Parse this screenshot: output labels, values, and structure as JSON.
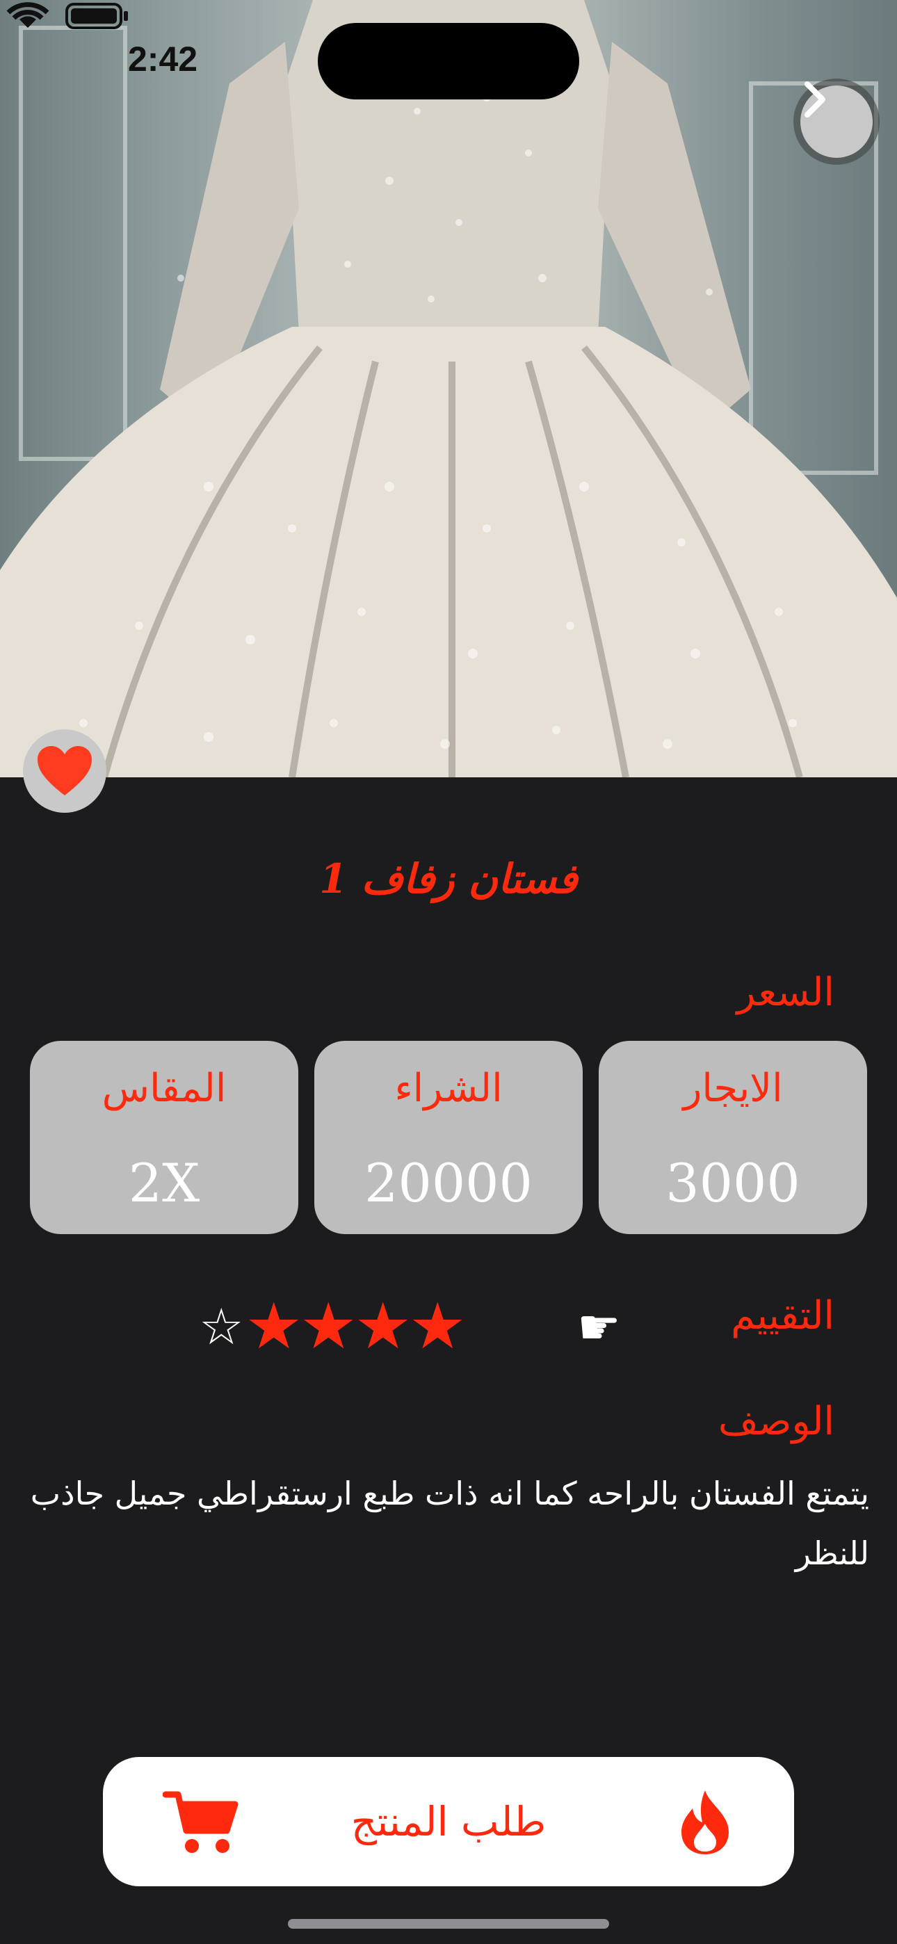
{
  "status_bar": {
    "time": "2:42"
  },
  "product": {
    "title": "فستان زفاف 1",
    "price_section_label": "السعر",
    "cards": [
      {
        "label": "الايجار",
        "value": "3000"
      },
      {
        "label": "الشراء",
        "value": "20000"
      },
      {
        "label": "المقاس",
        "value": "2X"
      }
    ],
    "rating_label": "التقييم",
    "rating": {
      "value": 4,
      "max": 5
    },
    "description_label": "الوصف",
    "description": "يتمتع الفستان بالراحه كما انه ذات طبع ارستقراطي جميل جاذب للنظر"
  },
  "order_button": {
    "label": "طلب المنتج"
  },
  "colors": {
    "accent": "#ff2a0e",
    "background": "#1c1c1e",
    "card": "#bdbdbd"
  },
  "icons": [
    "chevron-right-icon",
    "heart-icon",
    "pointing-hand-icon",
    "star-icon",
    "cart-icon",
    "fire-icon",
    "wifi-icon",
    "battery-icon"
  ]
}
